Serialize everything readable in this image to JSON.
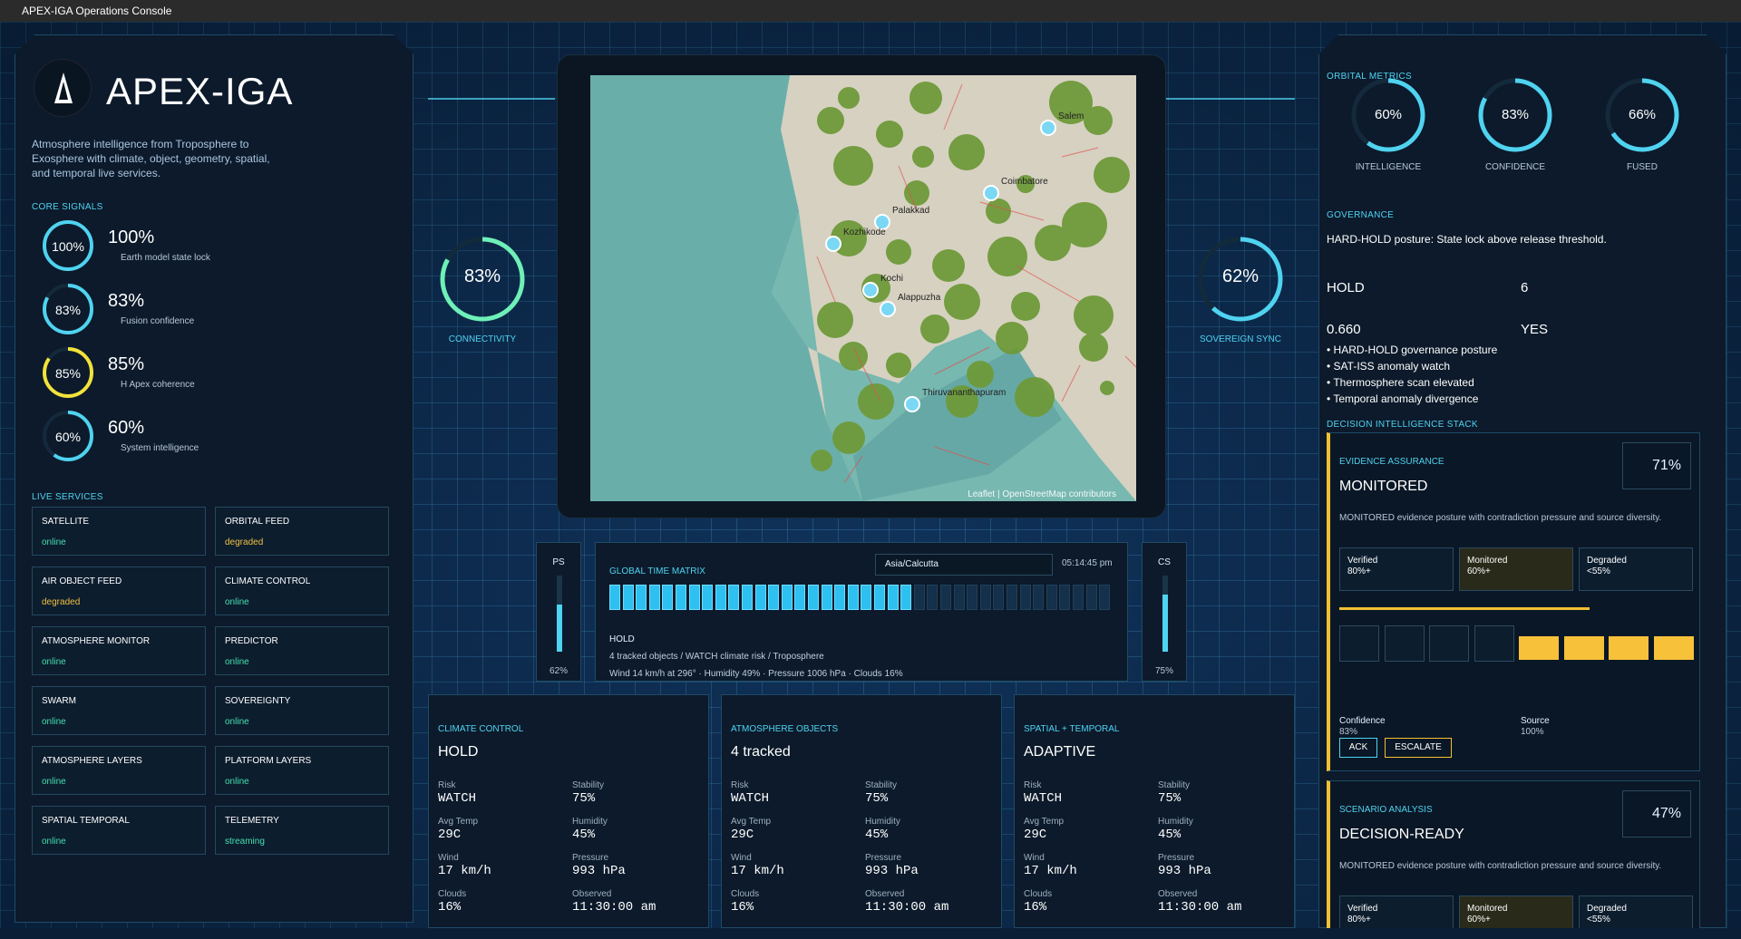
{
  "window": {
    "title": "APEX-IGA Operations Console"
  },
  "brand": {
    "name": "APEX-IGA",
    "tagline_lines": [
      "Atmosphere intelligence from Troposphere to",
      "Exosphere with climate, object, geometry, spatial,",
      "and temporal live services."
    ]
  },
  "core_signals": {
    "title": "CORE SIGNALS",
    "items": [
      {
        "pct": "100%",
        "value": "100%",
        "label": "Earth model state lock",
        "color": "#4fd3f0",
        "frac": 1.0
      },
      {
        "pct": "83%",
        "value": "83%",
        "label": "Fusion confidence",
        "color": "#4fd3f0",
        "frac": 0.83
      },
      {
        "pct": "85%",
        "value": "85%",
        "label": "H Apex coherence",
        "color": "#f2e23a",
        "frac": 0.85
      },
      {
        "pct": "60%",
        "value": "60%",
        "label": "System intelligence",
        "color": "#4fd3f0",
        "frac": 0.6
      }
    ]
  },
  "live_services": {
    "title": "LIVE SERVICES",
    "items": [
      {
        "name": "SATELLITE",
        "status": "online",
        "tone": "green"
      },
      {
        "name": "ORBITAL FEED",
        "status": "degraded",
        "tone": "amber"
      },
      {
        "name": "AIR OBJECT FEED",
        "status": "degraded",
        "tone": "amber"
      },
      {
        "name": "CLIMATE CONTROL",
        "status": "online",
        "tone": "green"
      },
      {
        "name": "ATMOSPHERE MONITOR",
        "status": "online",
        "tone": "green"
      },
      {
        "name": "PREDICTOR",
        "status": "online",
        "tone": "green"
      },
      {
        "name": "SWARM",
        "status": "online",
        "tone": "green"
      },
      {
        "name": "SOVEREIGNTY",
        "status": "online",
        "tone": "green"
      },
      {
        "name": "ATMOSPHERE LAYERS",
        "status": "online",
        "tone": "green"
      },
      {
        "name": "PLATFORM LAYERS",
        "status": "online",
        "tone": "green"
      },
      {
        "name": "SPATIAL TEMPORAL",
        "status": "online",
        "tone": "green"
      },
      {
        "name": "TELEMETRY",
        "status": "streaming",
        "tone": "green"
      }
    ]
  },
  "connectivity": {
    "pct": "83%",
    "label": "CONNECTIVITY",
    "frac": 0.83
  },
  "sovereign": {
    "pct": "62%",
    "label": "SOVEREIGN SYNC",
    "frac": 0.62
  },
  "map": {
    "attribution": "Leaflet | OpenStreetMap contributors",
    "places": [
      "Salem",
      "Coimbatore",
      "Palakkad",
      "Kozhikode",
      "Kochi",
      "Alappuzha",
      "Thiruvananthapuram"
    ]
  },
  "ps": {
    "label": "PS",
    "value": "62%",
    "frac": 0.62
  },
  "cs": {
    "label": "CS",
    "value": "75%",
    "frac": 0.75
  },
  "time_matrix": {
    "title": "GLOBAL TIME MATRIX",
    "timezone": "Asia/Calcutta",
    "time": "05:14:45 pm",
    "filled": 23,
    "total": 38,
    "status": "HOLD",
    "line1": "4 tracked objects / WATCH climate risk / Troposphere",
    "line2": "Wind 14 km/h at 296° · Humidity 49% · Pressure 1006 hPa · Clouds 16%"
  },
  "cards": [
    {
      "title": "CLIMATE CONTROL",
      "headline": "HOLD",
      "risk_k": "Risk",
      "risk": "WATCH",
      "stab_k": "Stability",
      "stab": "75%",
      "temp_k": "Avg Temp",
      "temp": "29C",
      "hum_k": "Humidity",
      "hum": "45%",
      "wind_k": "Wind",
      "wind": "17 km/h",
      "pres_k": "Pressure",
      "pres": "993 hPa",
      "cloud_k": "Clouds",
      "cloud": "16%",
      "obs_k": "Observed",
      "obs": "11:30:00 am"
    },
    {
      "title": "ATMOSPHERE OBJECTS",
      "headline": "4 tracked",
      "risk_k": "Risk",
      "risk": "WATCH",
      "stab_k": "Stability",
      "stab": "75%",
      "temp_k": "Avg Temp",
      "temp": "29C",
      "hum_k": "Humidity",
      "hum": "45%",
      "wind_k": "Wind",
      "wind": "17 km/h",
      "pres_k": "Pressure",
      "pres": "993 hPa",
      "cloud_k": "Clouds",
      "cloud": "16%",
      "obs_k": "Observed",
      "obs": "11:30:00 am"
    },
    {
      "title": "SPATIAL + TEMPORAL",
      "headline": "ADAPTIVE",
      "risk_k": "Risk",
      "risk": "WATCH",
      "stab_k": "Stability",
      "stab": "75%",
      "temp_k": "Avg Temp",
      "temp": "29C",
      "hum_k": "Humidity",
      "hum": "45%",
      "wind_k": "Wind",
      "wind": "17 km/h",
      "pres_k": "Pressure",
      "pres": "993 hPa",
      "cloud_k": "Clouds",
      "cloud": "16%",
      "obs_k": "Observed",
      "obs": "11:30:00 am"
    }
  ],
  "orbital": {
    "title": "ORBITAL METRICS",
    "items": [
      {
        "pct": "60%",
        "label": "INTELLIGENCE",
        "frac": 0.6
      },
      {
        "pct": "83%",
        "label": "CONFIDENCE",
        "frac": 0.83
      },
      {
        "pct": "66%",
        "label": "FUSED",
        "frac": 0.66
      }
    ]
  },
  "governance": {
    "title": "GOVERNANCE",
    "text": "HARD-HOLD posture: State lock above release threshold.",
    "hold": "HOLD",
    "count": "6",
    "score": "0.660",
    "yes": "YES",
    "bullets": [
      "• HARD-HOLD governance posture",
      "• SAT-ISS anomaly watch",
      "• Thermosphere scan elevated",
      "• Temporal anomaly divergence"
    ]
  },
  "dis": {
    "title": "DECISION INTELLIGENCE STACK",
    "evidence": {
      "title": "EVIDENCE ASSURANCE",
      "headline": "MONITORED",
      "pct": "71%",
      "desc": "MONITORED evidence posture with contradiction pressure and source diversity.",
      "chips": [
        {
          "t": "Verified",
          "v": "80%+"
        },
        {
          "t": "Monitored",
          "v": "60%+"
        },
        {
          "t": "Degraded",
          "v": "<55%"
        }
      ],
      "conf_k": "Confidence",
      "conf": "83%",
      "src_k": "Source",
      "src": "100%",
      "ack": "ACK",
      "escalate": "ESCALATE"
    },
    "scenario": {
      "title": "SCENARIO ANALYSIS",
      "headline": "DECISION-READY",
      "pct": "47%",
      "desc": "MONITORED evidence posture with contradiction pressure and source diversity.",
      "chips": [
        {
          "t": "Verified",
          "v": "80%+"
        },
        {
          "t": "Monitored",
          "v": "60%+"
        },
        {
          "t": "Degraded",
          "v": "<55%"
        }
      ]
    }
  }
}
